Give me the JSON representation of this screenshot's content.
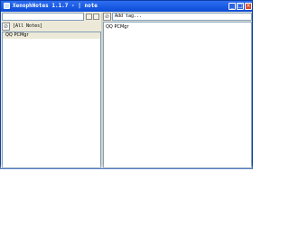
{
  "window": {
    "title": "XenophNotes 1.1.7 - | note"
  },
  "toolbar": {
    "search_value": ""
  },
  "filter": {
    "label": "[All Notes]"
  },
  "notes_list": {
    "items": [
      {
        "title": "QQ PCMgr"
      }
    ]
  },
  "editor": {
    "tag_placeholder": "Add tag...",
    "content": "QQ PCMgr"
  }
}
